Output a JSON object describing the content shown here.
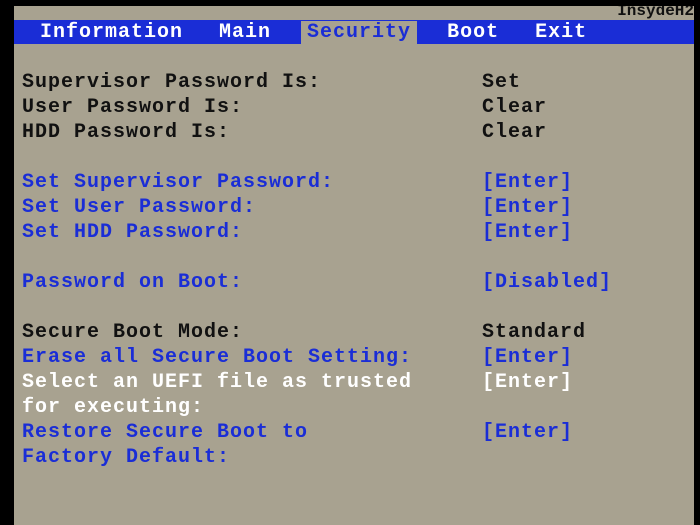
{
  "vendor": "InsydeH2",
  "tabs": {
    "information": "Information",
    "main": "Main",
    "security": "Security",
    "boot": "Boot",
    "exit": "Exit"
  },
  "status": {
    "supervisor_pw_label": "Supervisor Password Is:",
    "supervisor_pw_value": "Set",
    "user_pw_label": "User Password Is:",
    "user_pw_value": "Clear",
    "hdd_pw_label": "HDD Password Is:",
    "hdd_pw_value": "Clear"
  },
  "actions": {
    "set_supervisor_label": "Set Supervisor Password:",
    "set_supervisor_value": "[Enter]",
    "set_user_label": "Set User Password:",
    "set_user_value": "[Enter]",
    "set_hdd_label": "Set HDD Password:",
    "set_hdd_value": "[Enter]",
    "pw_on_boot_label": "Password on Boot:",
    "pw_on_boot_value": "[Disabled]",
    "secure_mode_label": "Secure Boot Mode:",
    "secure_mode_value": "Standard",
    "erase_sb_label": "Erase all Secure Boot Setting:",
    "erase_sb_value": "[Enter]",
    "select_uefi_label1": "Select an UEFI file as trusted",
    "select_uefi_label2": "for executing:",
    "select_uefi_value": "[Enter]",
    "restore_sb_label1": "Restore Secure Boot to",
    "restore_sb_label2": "Factory Default:",
    "restore_sb_value": "[Enter]"
  }
}
